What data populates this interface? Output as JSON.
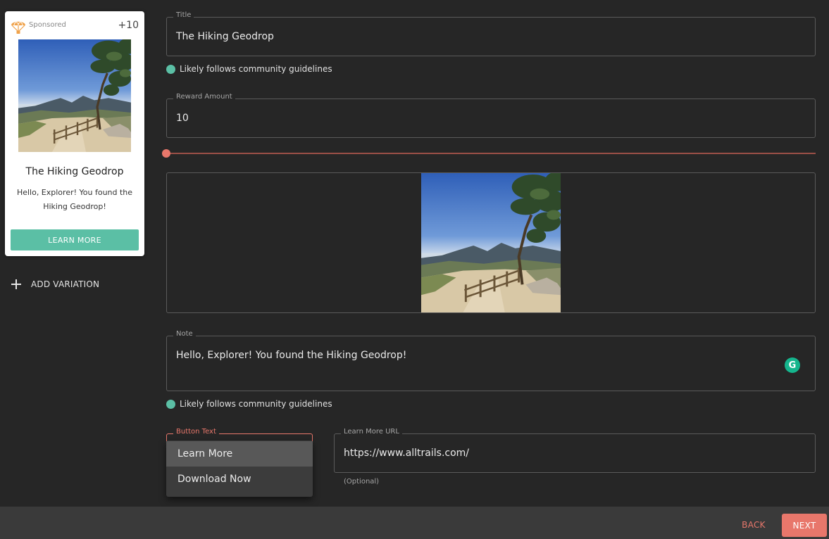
{
  "preview": {
    "sponsored_label": "Sponsored",
    "reward": "+10",
    "title": "The Hiking Geodrop",
    "note": "Hello, Explorer! You found the Hiking Geodrop!",
    "button_label": "LEARN MORE",
    "logo_icon": "parachute-icon"
  },
  "add_variation_label": "ADD VARIATION",
  "form": {
    "title": {
      "label": "Title",
      "value": "The Hiking Geodrop"
    },
    "title_status": "Likely follows community guidelines",
    "reward": {
      "label": "Reward Amount",
      "value": "10",
      "slider_fraction": 0.0
    },
    "note": {
      "label": "Note",
      "value": "Hello, Explorer! You found the Hiking Geodrop!"
    },
    "note_status": "Likely follows community guidelines",
    "button_text": {
      "label": "Button Text",
      "options": [
        "Learn More",
        "Download Now"
      ],
      "selected": "Learn More"
    },
    "learn_more_url": {
      "label": "Learn More URL",
      "value": "https://www.alltrails.com/",
      "helper": "(Optional)"
    }
  },
  "footer": {
    "back_label": "BACK",
    "next_label": "NEXT"
  },
  "colors": {
    "accent": "#e8776b",
    "teal": "#5bbfa5",
    "background": "#262626",
    "footer": "#3a3a3a"
  }
}
